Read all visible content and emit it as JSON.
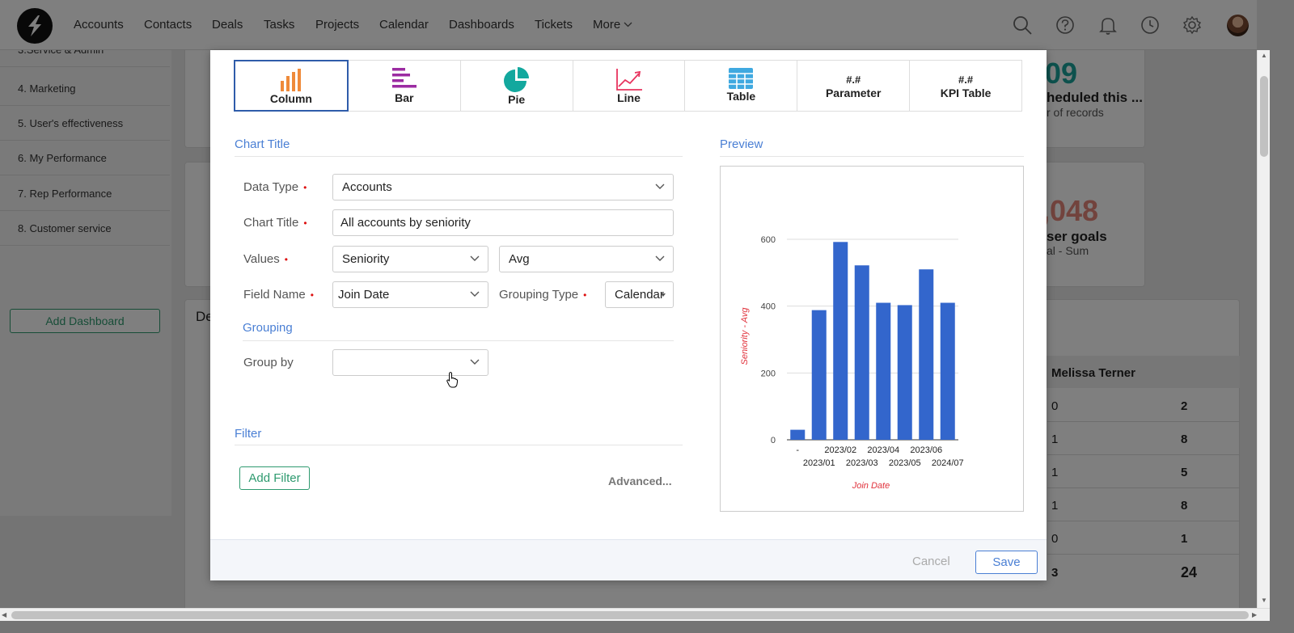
{
  "nav": {
    "items": [
      "Accounts",
      "Contacts",
      "Deals",
      "Tasks",
      "Projects",
      "Calendar",
      "Dashboards",
      "Tickets"
    ],
    "more_label": "More",
    "icons": [
      "search-icon",
      "help-icon",
      "bell-icon",
      "clock-icon",
      "gear-icon"
    ]
  },
  "sidebar": {
    "items": [
      "3.Service & Admin",
      "4. Marketing",
      "5. User's effectiveness",
      "6. My Performance",
      "7. Rep Performance",
      "8. Customer service"
    ],
    "add_dashboard": "Add Dashboard"
  },
  "background": {
    "kpi1": {
      "value": "09",
      "label": "heduled this ...",
      "sub": "r of records"
    },
    "kpi2": {
      "value": ",048",
      "label": "ser goals",
      "sub": "al - Sum"
    },
    "card_title": "De",
    "table": {
      "header": "Melissa Terner",
      "rows": [
        [
          "0",
          "2"
        ],
        [
          "1",
          "8"
        ],
        [
          "1",
          "5"
        ],
        [
          "1",
          "8"
        ],
        [
          "0",
          "1"
        ]
      ],
      "total": [
        "3",
        "24"
      ]
    }
  },
  "modal": {
    "chart_types": [
      {
        "label": "Column",
        "icon": "column-chart-icon"
      },
      {
        "label": "Bar",
        "icon": "bar-chart-icon"
      },
      {
        "label": "Pie",
        "icon": "pie-chart-icon"
      },
      {
        "label": "Line",
        "icon": "line-chart-icon"
      },
      {
        "label": "Table",
        "icon": "table-icon"
      },
      {
        "label": "Parameter",
        "hash": "#.#"
      },
      {
        "label": "KPI Table",
        "hash": "#.#"
      }
    ],
    "active_type": "Column",
    "sections": {
      "chart_title": "Chart Title",
      "preview": "Preview",
      "grouping": "Grouping",
      "filter": "Filter"
    },
    "form": {
      "data_type_label": "Data Type",
      "data_type_value": "Accounts",
      "chart_title_label": "Chart Title",
      "chart_title_value": "All accounts by seniority",
      "values_label": "Values",
      "values_field": "Seniority",
      "values_agg": "Avg",
      "field_name_label": "Field Name",
      "field_name_value": "Join Date",
      "grouping_type_label": "Grouping Type",
      "grouping_type_value": "Calendar",
      "group_by_label": "Group by",
      "group_by_value": ""
    },
    "add_filter": "Add Filter",
    "advanced": "Advanced...",
    "footer": {
      "cancel": "Cancel",
      "save": "Save"
    }
  },
  "chart_data": {
    "type": "bar",
    "categories": [
      "-",
      "2023/01",
      "2023/02",
      "2023/03",
      "2023/04",
      "2023/05",
      "2023/06",
      "2024/07"
    ],
    "values": [
      30,
      388,
      592,
      522,
      410,
      403,
      510,
      410
    ],
    "xlabel": "Join Date",
    "ylabel": "Seniority - Avg",
    "ylim": [
      0,
      600
    ],
    "yticks": [
      0,
      200,
      400,
      600
    ],
    "grid": true,
    "bar_color": "#3366cc",
    "axis_label_color": "#e0323c"
  }
}
